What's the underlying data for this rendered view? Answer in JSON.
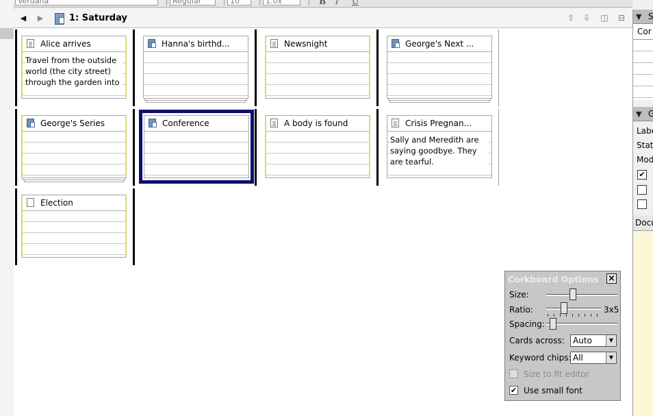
{
  "format_bar": {
    "font": "Verdana",
    "style": "Regular",
    "size": "10",
    "spacing": "1.0x",
    "bold_icon": "B",
    "italic_icon": "I",
    "underline_icon": "U"
  },
  "header": {
    "title": "1: Saturday",
    "back_icon": "◀",
    "forward_icon": "▶"
  },
  "cards": [
    {
      "title": "Alice arrives",
      "synopsis": "Travel from the outside world (the city street) through the garden into",
      "icon": "page",
      "selected": false
    },
    {
      "title": "Hanna's birthd...",
      "synopsis": "",
      "icon": "folder",
      "selected": false
    },
    {
      "title": "Newsnight",
      "synopsis": "",
      "icon": "page",
      "selected": false
    },
    {
      "title": "George's Next ...",
      "synopsis": "",
      "icon": "folder",
      "selected": false
    },
    {
      "title": "George's Series",
      "synopsis": "",
      "icon": "folder",
      "selected": false
    },
    {
      "title": "Conference",
      "synopsis": "",
      "icon": "folder",
      "selected": true
    },
    {
      "title": "A body is found",
      "synopsis": "",
      "icon": "page",
      "selected": false
    },
    {
      "title": "Crisis Pregnan...",
      "synopsis": "Sally and Meredith are saying goodbye. They are tearful.",
      "icon": "page",
      "selected": false
    },
    {
      "title": "Election",
      "synopsis": "",
      "icon": "page-empty",
      "selected": false
    }
  ],
  "inspector": {
    "section1_header": "S",
    "field1": "Cor",
    "section2_header": "G",
    "label_text": "Labe",
    "status_text": "Stat",
    "modified_text": "Mod",
    "docnotes_text": "Docu"
  },
  "options_panel": {
    "title": "Corkboard Options",
    "close_label": "×",
    "size_label": "Size:",
    "size_value": 0.36,
    "ratio_label": "Ratio:",
    "ratio_value_text": "3x5",
    "ratio_value": 0.3,
    "spacing_label": "Spacing:",
    "spacing_value": 0.05,
    "cards_across_label": "Cards across:",
    "cards_across_value": "Auto",
    "keyword_chips_label": "Keyword chips:",
    "keyword_chips_value": "All",
    "size_to_fit_label": "Size to fit editor",
    "size_to_fit_checked": false,
    "small_font_label": "Use small font",
    "small_font_checked": true
  }
}
